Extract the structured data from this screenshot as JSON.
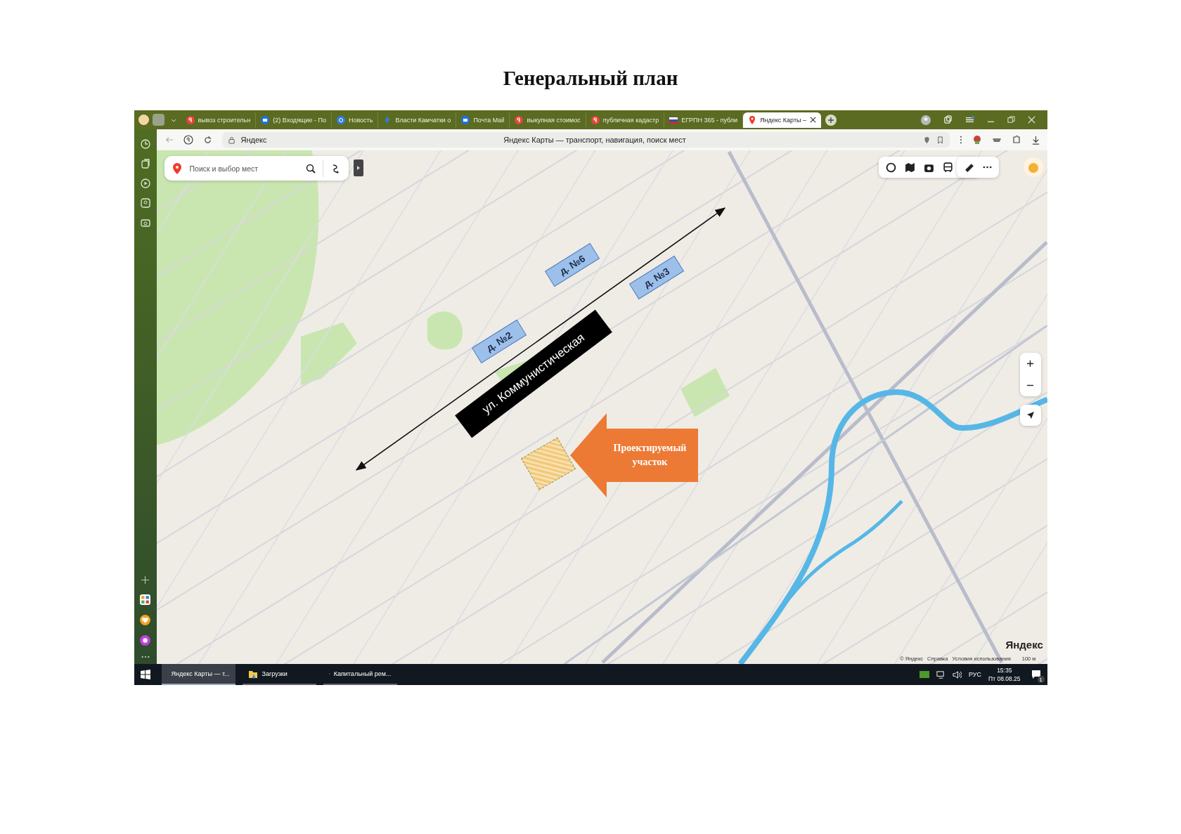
{
  "page_title": "Генеральный план",
  "browser": {
    "tabs": [
      {
        "label": "вывоз строительн",
        "kind": "red",
        "selected": false
      },
      {
        "label": "(2) Входящие - По",
        "kind": "mail",
        "selected": false
      },
      {
        "label": "Новость",
        "kind": "at",
        "selected": false
      },
      {
        "label": "Власти Камчатки о",
        "kind": "bolt",
        "selected": false
      },
      {
        "label": "Почта Mail",
        "kind": "mail",
        "selected": false
      },
      {
        "label": "выкупная стоимос",
        "kind": "red",
        "selected": false
      },
      {
        "label": "публичная кадастр",
        "kind": "red",
        "selected": false
      },
      {
        "label": "ЕГРПН 365 - публи",
        "kind": "flag",
        "selected": false
      },
      {
        "label": "Яндекс Карты –",
        "kind": "pin",
        "selected": true
      }
    ],
    "address": "Яндекс",
    "page_heading": "Яндекс Карты — транспорт, навигация, поиск мест"
  },
  "map": {
    "search": {
      "placeholder": "Поиск и выбор мест"
    },
    "annotations": [
      {
        "kind": "village",
        "label": "д. №6"
      },
      {
        "kind": "village",
        "label": "д. №3"
      },
      {
        "kind": "village",
        "label": "д. №2"
      },
      {
        "kind": "street",
        "label": "ул. Коммунистическая"
      },
      {
        "kind": "plot",
        "label": "Проектируемый участок"
      }
    ],
    "logo": "Яндекс",
    "footer_links": [
      "© Яндекс",
      "Справка",
      "Условия использования"
    ],
    "scale": "100 м"
  },
  "taskbar": {
    "apps": [
      {
        "label": "Яндекс Карты — т...",
        "kind": "browser",
        "selected": true
      },
      {
        "label": "Загрузки",
        "kind": "folder",
        "selected": false
      },
      {
        "label": "Капитальный рем...",
        "kind": "excel",
        "selected": false
      }
    ],
    "language": "РУС",
    "time": "15:35",
    "date": "Пт 08.08.25",
    "notifications": "1"
  }
}
